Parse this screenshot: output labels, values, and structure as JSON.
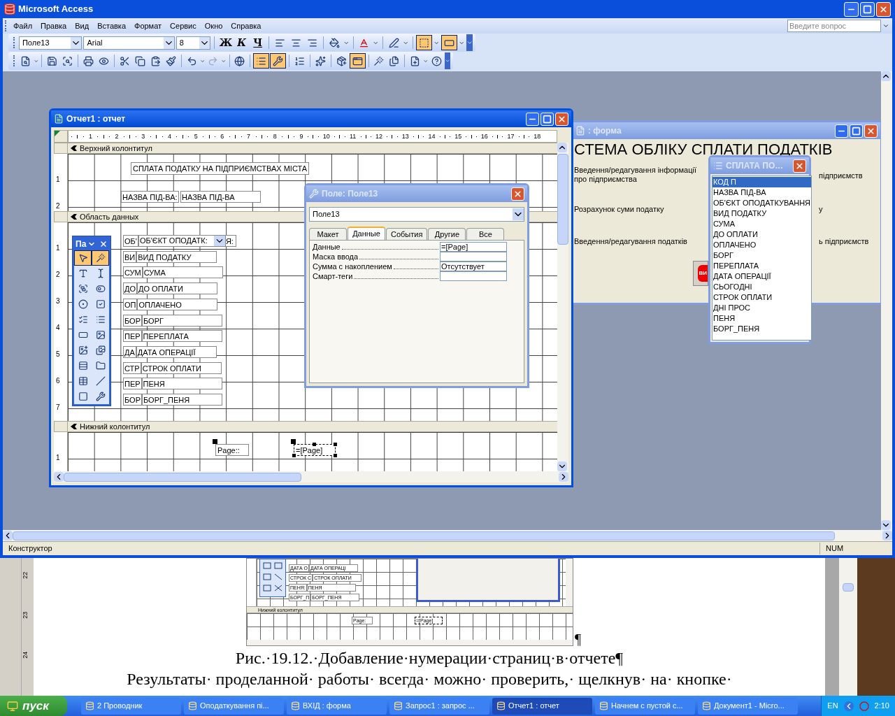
{
  "app": {
    "title": "Microsoft Access",
    "help_placeholder": "Введите вопрос"
  },
  "menu": [
    "Файл",
    "Правка",
    "Вид",
    "Вставка",
    "Формат",
    "Сервис",
    "Окно",
    "Справка"
  ],
  "format_toolbar": {
    "object": "Поле13",
    "font": "Arial",
    "size": "8",
    "text_buttons": [
      {
        "label": "Ж",
        "on": false
      },
      {
        "label": "К",
        "on": false
      },
      {
        "label": "Ч",
        "on": false
      }
    ],
    "tools": [
      {
        "on": false
      },
      {
        "on": false
      },
      {
        "on": false
      },
      {
        "on": false
      },
      {
        "on": false
      },
      {
        "on": false
      },
      {
        "on": true
      },
      {
        "on": true
      }
    ]
  },
  "design_toolbar": [
    {
      "on": false
    },
    {
      "on": false
    },
    {
      "on": false
    },
    {
      "on": false
    },
    {
      "on": false
    },
    {
      "on": false
    },
    {
      "on": false
    },
    {
      "on": false
    },
    {
      "on": false
    },
    {
      "on": false
    },
    {
      "on": false
    },
    {
      "on": false
    },
    {
      "on": true
    },
    {
      "on": true
    },
    {
      "on": false
    },
    {
      "on": false
    },
    {
      "on": false
    },
    {
      "on": true
    },
    {
      "on": false
    },
    {
      "on": false
    },
    {
      "on": false
    },
    {
      "on": false
    }
  ],
  "form": {
    "title": ": форма",
    "active": false,
    "heading": "СТЕМА ОБЛІКУ СПЛАТИ ПОДАТКІВ",
    "rows": [
      {
        "left": "Введення/редагування інформації про підприємства",
        "right": "підприємств"
      },
      {
        "left": "Розрахунок суми податку",
        "right": "у"
      },
      {
        "left": "Введення/редагування податків",
        "right": "ь підприємств"
      }
    ],
    "exit_button": "ВИ"
  },
  "report": {
    "title": "Отчет1 : отчет",
    "active": true,
    "ruler": [
      "1",
      "2",
      "3",
      "4",
      "5",
      "6",
      "7",
      "8",
      "9",
      "10",
      "11",
      "12",
      "13",
      "14",
      "15",
      "16",
      "17",
      "18"
    ],
    "page_header": {
      "title": "Верхний колонтитул",
      "ruler": [
        "1",
        "2"
      ],
      "heading": "СПЛАТА ПОДАТКУ НА ПІДПРИЄМСТВАХ МІСТА",
      "name_label": "НАЗВА ПІД-ВА:",
      "name_field": "НАЗВА ПІД-ВА"
    },
    "detail": {
      "title": "Область данных",
      "ruler": [
        "1",
        "2",
        "3",
        "4",
        "5",
        "6",
        "7"
      ],
      "rows": [
        {
          "kind": "combo",
          "label": "ОБ'",
          "field": "ОБ'ЄКТ ОПОДАТК:",
          "tail": "Я:"
        },
        {
          "kind": "text",
          "label": "ВИ",
          "field": "ВИД ПОДАТКУ"
        },
        {
          "kind": "text",
          "label": "СУМ",
          "field": "СУМА"
        },
        {
          "kind": "text",
          "label": "ДО",
          "field": "ДО ОПЛАТИ"
        },
        {
          "kind": "text",
          "label": "ОП",
          "field": "ОПЛАЧЕНО"
        },
        {
          "kind": "text",
          "label": "БОР",
          "field": "БОРГ"
        },
        {
          "kind": "text",
          "label": "ПЕР",
          "field": "ПЕРЕПЛАТА"
        },
        {
          "kind": "text",
          "label": "ДА",
          "field": "ДАТА ОПЕРАЦІЇ"
        },
        {
          "kind": "text",
          "label": "СТР",
          "field": "СТРОК ОПЛАТИ"
        },
        {
          "kind": "text",
          "label": "ПЕР",
          "field": "ПЕНЯ"
        },
        {
          "kind": "text",
          "label": "БОР",
          "field": "БОРГ_ПЕНЯ"
        }
      ]
    },
    "page_footer": {
      "title": "Нижний колонтитул",
      "ruler": [
        "1"
      ],
      "controls": [
        {
          "text": "Page::",
          "selected": false
        },
        {
          "text": "=[Page]",
          "selected": true
        }
      ]
    }
  },
  "toolbox": {
    "title": "Па",
    "tools": [
      {
        "on": true
      },
      {
        "on": true
      },
      {
        "on": false
      },
      {
        "on": false
      },
      {
        "on": false
      },
      {
        "on": false
      },
      {
        "on": false
      },
      {
        "on": false
      },
      {
        "on": false
      },
      {
        "on": false
      },
      {
        "on": false
      },
      {
        "on": false
      },
      {
        "on": false
      },
      {
        "on": false
      },
      {
        "on": false
      },
      {
        "on": false
      },
      {
        "on": false
      },
      {
        "on": false
      },
      {
        "on": false
      },
      {
        "on": false
      }
    ]
  },
  "properties": {
    "title": "Поле: Поле13",
    "active": false,
    "object": "Поле13",
    "tabs": [
      {
        "label": "Макет",
        "selected": false
      },
      {
        "label": "Данные",
        "selected": true
      },
      {
        "label": "События",
        "selected": false
      },
      {
        "label": "Другие",
        "selected": false
      },
      {
        "label": "Все",
        "selected": false
      }
    ],
    "rows": [
      {
        "name": "Данные",
        "value": "=[Page]"
      },
      {
        "name": "Маска ввода"
      },
      {
        "name": "Сумма с накоплением",
        "value": "Отсутствует"
      },
      {
        "name": "Смарт-теги"
      }
    ]
  },
  "field_list": {
    "title": "СПЛАТА ПО…",
    "active": false,
    "fields": [
      {
        "name": "КОД П",
        "selected": true
      },
      {
        "name": "НАЗВА ПІД-ВА",
        "selected": false
      },
      {
        "name": "ОБ'ЄКТ ОПОДАТКУВАННЯ",
        "selected": false
      },
      {
        "name": "ВИД ПОДАТКУ",
        "selected": false
      },
      {
        "name": "СУМА",
        "selected": false
      },
      {
        "name": "ДО ОПЛАТИ",
        "selected": false
      },
      {
        "name": "ОПЛАЧЕНО",
        "selected": false
      },
      {
        "name": "БОРГ",
        "selected": false
      },
      {
        "name": "ПЕРЕПЛАТА",
        "selected": false
      },
      {
        "name": "ДАТА ОПЕРАЦІЇ",
        "selected": false
      },
      {
        "name": "СЬОГОДНІ",
        "selected": false
      },
      {
        "name": "СТРОК ОПЛАТИ",
        "selected": false
      },
      {
        "name": "ДНІ ПРОС",
        "selected": false
      },
      {
        "name": "ПЕНЯ",
        "selected": false
      },
      {
        "name": "БОРГ_ПЕНЯ",
        "selected": false
      }
    ]
  },
  "status_bar": {
    "mode": "Конструктор",
    "num": "NUM"
  },
  "document": {
    "ruler": [
      "22",
      "23",
      "24"
    ],
    "figure": {
      "rows": [
        {
          "label": "ДАТА О",
          "field": "ДАТА ОПЕРАЦІ"
        },
        {
          "label": "СТРОК С",
          "field": "СТРОК ОПЛАТИ"
        },
        {
          "label": "ПЕНЯ:",
          "field": "ПЕНЯ"
        },
        {
          "label": "БОРГ_П",
          "field": "БОРГ_ПЕНЯ"
        }
      ],
      "section": "Нижний колонтитул",
      "page_label": "Page:",
      "page_field": "=[Page]"
    },
    "mark": "¶",
    "caption": "Рис.·19.12.·Добавление·нумерации·страниц·в·отчете¶",
    "text": "Результаты· проделанной· работы· всегда· можно· проверить,· щелкнув· на· кнопке·"
  },
  "taskbar": {
    "start": "пуск",
    "tasks": [
      {
        "label": "2 Проводник",
        "selected": false
      },
      {
        "label": "Оподаткування пі...",
        "selected": false
      },
      {
        "label": "ВХІД : форма",
        "selected": false
      },
      {
        "label": "Запрос1 : запрос ...",
        "selected": false
      },
      {
        "label": "Отчет1 : отчет",
        "selected": true
      },
      {
        "label": "Начнем с пустой с...",
        "selected": false
      },
      {
        "label": "Документ1 - Micro...",
        "selected": false
      }
    ],
    "lang": "EN",
    "clock": "2:10"
  }
}
